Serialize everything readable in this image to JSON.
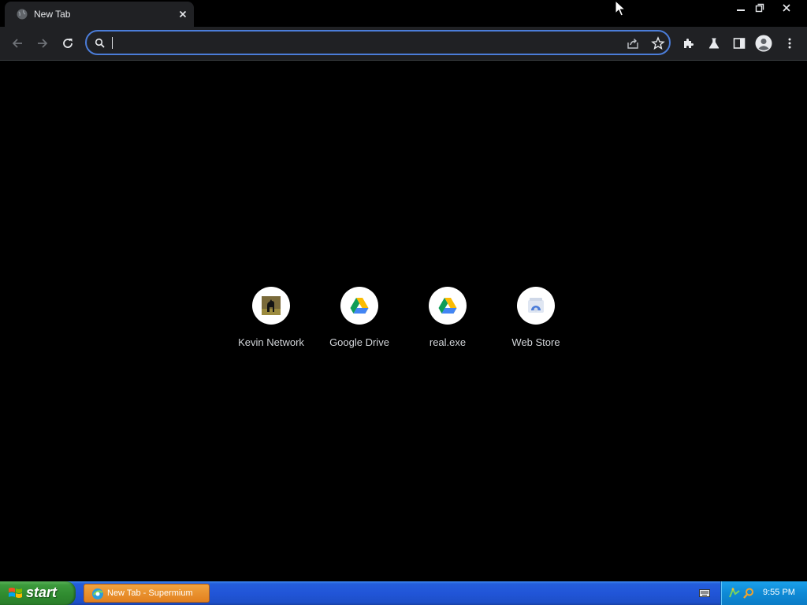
{
  "browser": {
    "tab": {
      "title": "New Tab",
      "favicon": "globe-icon",
      "close_icon": "close-icon"
    },
    "window_controls": [
      "minimize-icon",
      "restore-icon",
      "close-icon"
    ],
    "toolbar": {
      "back_icon": "back-arrow-icon",
      "forward_icon": "forward-arrow-icon",
      "reload_icon": "reload-icon",
      "omnibox": {
        "value": "",
        "placeholder": "",
        "search_icon": "search-icon",
        "share_icon": "share-icon",
        "bookmark_icon": "star-icon"
      },
      "extensions_icon": "puzzle-piece-icon",
      "labs_icon": "flask-icon",
      "side_panel_icon": "side-panel-icon",
      "profile_icon": "avatar-icon",
      "menu_icon": "more-vert-icon"
    },
    "accent_color": "#4b7dd9"
  },
  "shortcuts": [
    {
      "label": "Kevin Network",
      "icon": "horse-thumbnail-icon"
    },
    {
      "label": "Google Drive",
      "icon": "google-drive-icon"
    },
    {
      "label": "real.exe",
      "icon": "google-drive-icon"
    },
    {
      "label": "Web Store",
      "icon": "web-store-icon"
    }
  ],
  "taskbar": {
    "start_label": "start",
    "task_item_label": "New Tab - Supermium",
    "clock": "9:55 PM",
    "tray_icons": [
      "network-icon",
      "search-icon"
    ],
    "keyboard_icon": "keyboard-icon"
  }
}
